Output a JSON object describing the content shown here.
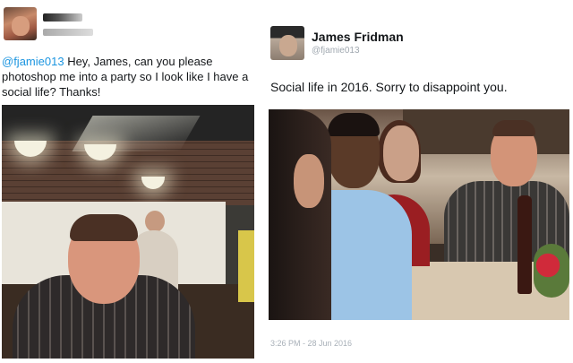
{
  "left_tweet": {
    "mention": "@fjamie013",
    "text": " Hey, James, can you please photoshop me into a party so I look like I have a social life? Thanks!",
    "avatar_icon": "user-avatar-photo",
    "photo_icon": "attached-photo"
  },
  "right_tweet": {
    "name": "James Fridman",
    "handle": "@fjamie013",
    "text": "Social life in 2016. Sorry to disappoint you.",
    "timestamp": "3:26 PM - 28 Jun 2016",
    "avatar_icon": "user-avatar-photo",
    "photo_icon": "attached-photo"
  },
  "colors": {
    "mention": "#1b95e0",
    "text": "#14171a",
    "muted": "#a0a8b0"
  }
}
